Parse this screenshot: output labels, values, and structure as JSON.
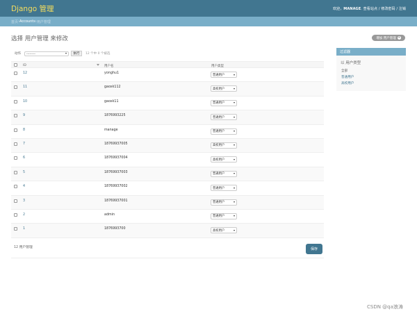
{
  "header": {
    "brand": "Django 管理",
    "welcome": "欢迎，",
    "username": "MANAGE",
    "links": "查看站点 / 修改密码 / 注销"
  },
  "breadcrumbs": {
    "home": "首页",
    "sep1": " › ",
    "app": "Accounts",
    "sep2": " › ",
    "current": "用户管理"
  },
  "page": {
    "title": "选择 用户管理 来修改",
    "add_button": "增加 用户管理",
    "add_icon": "+"
  },
  "actions": {
    "label": "动作",
    "select_value": "---------",
    "go_button": "执行",
    "selected_count": "12 个中 0 个被选"
  },
  "table": {
    "columns": [
      "ID",
      "用户名",
      "用户类型"
    ],
    "rows": [
      {
        "id": "12",
        "username": "yonghu1",
        "type": "普通用户"
      },
      {
        "id": "11",
        "username": "gaoxk112",
        "type": "高校用户"
      },
      {
        "id": "10",
        "username": "gaoxk11",
        "type": "普通用户"
      },
      {
        "id": "9",
        "username": "1876993225",
        "type": "普通用户"
      },
      {
        "id": "8",
        "username": "manage",
        "type": "普通用户"
      },
      {
        "id": "7",
        "username": "18769937005",
        "type": "高校用户"
      },
      {
        "id": "6",
        "username": "18769937004",
        "type": "高校用户"
      },
      {
        "id": "5",
        "username": "18769937003",
        "type": "普通用户"
      },
      {
        "id": "4",
        "username": "18769937002",
        "type": "普通用户"
      },
      {
        "id": "3",
        "username": "18769937001",
        "type": "普通用户"
      },
      {
        "id": "2",
        "username": "admin",
        "type": "普通用户"
      },
      {
        "id": "1",
        "username": "1876993700",
        "type": "高校用户"
      }
    ]
  },
  "footer": {
    "count": "12 用户管理",
    "save_button": "保存"
  },
  "filter": {
    "title": "过滤器",
    "subtitle": "以 用户类型",
    "options": [
      "全部",
      "普通用户",
      "高校用户"
    ]
  },
  "watermark": "CSDN @qa浪涛"
}
